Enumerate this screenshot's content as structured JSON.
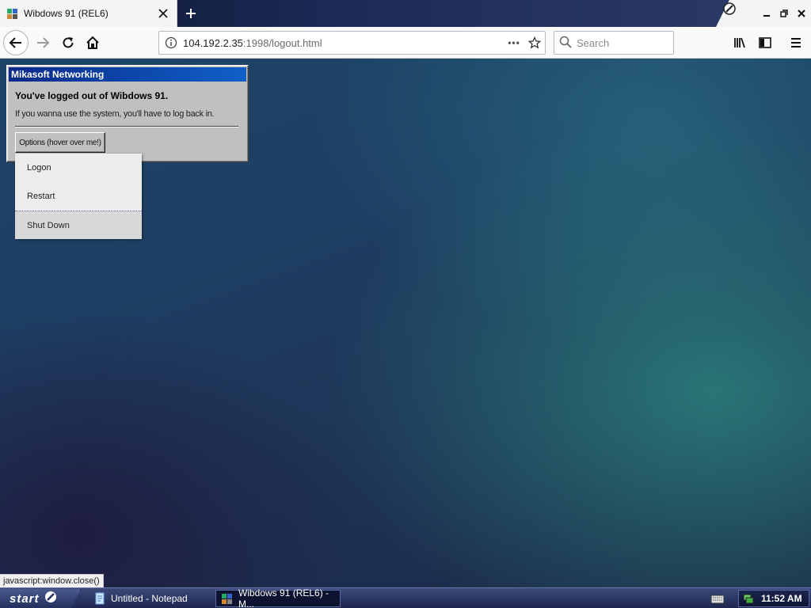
{
  "browser": {
    "tab_title": "Wibdows 91 (REL6)",
    "url_host": "104.192.2.35",
    "url_rest": ":1998/logout.html",
    "url_actions": "•••",
    "search_placeholder": "Search"
  },
  "dialog": {
    "title": "Mikasoft Networking",
    "heading": "You've logged out of Wibdows 91.",
    "message": "If you wanna use the system, you'll have to log back in.",
    "options_label": "Options (hover over me!)"
  },
  "menu": {
    "items": [
      "Logon",
      "Restart",
      "Shut Down"
    ]
  },
  "status_link": "javascript:window.close()",
  "taskbar": {
    "start_label": "start",
    "tasks": [
      "Untitled - Notepad",
      "Wibdows 91 (REL6) - M..."
    ],
    "clock": "11:52 AM"
  },
  "colors": {
    "title_bar": "#1060c8",
    "dialog_face": "#c0c0c0",
    "taskbar": "#1d2750"
  },
  "icons": [
    "app-favicon",
    "close-icon",
    "plus-icon",
    "private-browsing-icon",
    "minimize-icon",
    "restore-icon",
    "window-close-icon",
    "back-arrow-icon",
    "forward-arrow-icon",
    "reload-icon",
    "home-icon",
    "info-icon",
    "star-icon",
    "search-icon",
    "library-icon",
    "sidebar-icon",
    "menu-icon",
    "start-logo-icon",
    "notepad-icon",
    "keyboard-icon",
    "network-icon"
  ]
}
